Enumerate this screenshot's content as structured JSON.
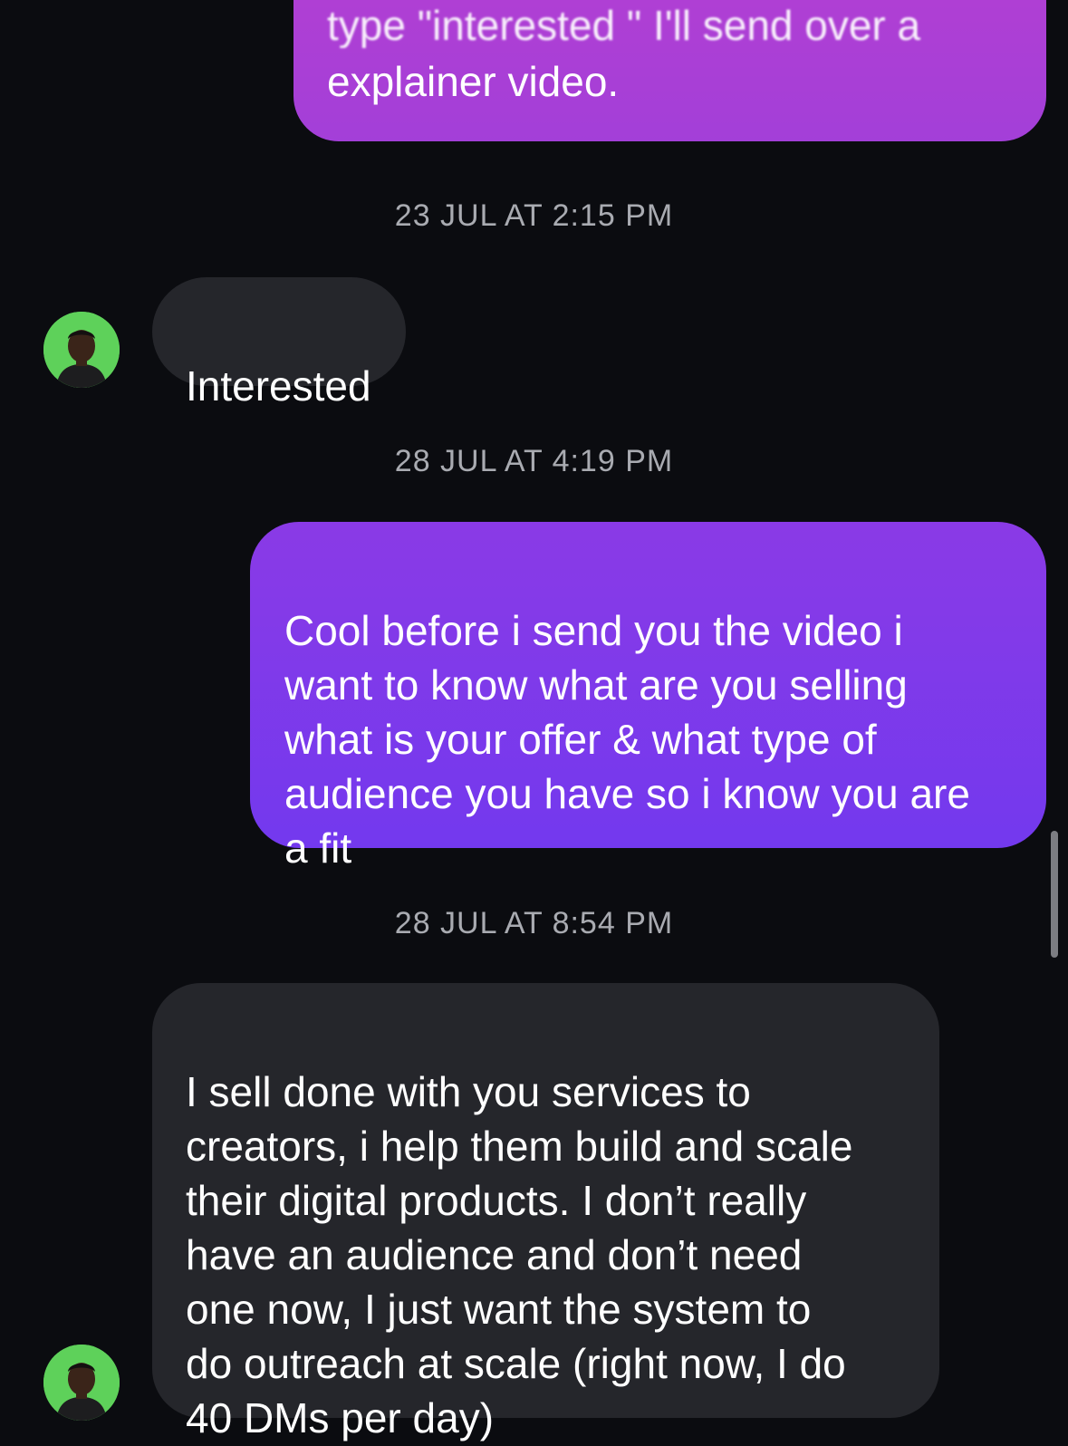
{
  "messages": [
    {
      "direction": "outgoing",
      "partial_line": "type \"interested \" I'll send over a",
      "text": "explainer video."
    },
    {
      "timestamp": "23 JUL AT 2:15 PM"
    },
    {
      "direction": "incoming",
      "text": "Interested"
    },
    {
      "timestamp": "28 JUL AT 4:19 PM"
    },
    {
      "direction": "outgoing",
      "text": "Cool before i send you the video i\nwant to know what are you selling\nwhat is your offer & what type of\naudience you have so i know you are\na fit"
    },
    {
      "timestamp": "28 JUL AT 8:54 PM"
    },
    {
      "direction": "incoming",
      "text": "I sell done with you services to\ncreators, i help them build and scale\ntheir digital products. I don’t really\nhave an audience and don’t need\none now, I just want the system to\ndo outreach at scale (right now, I do\n40 DMs per day)"
    }
  ],
  "colors": {
    "background": "#0b0c10",
    "incoming_bubble": "#25262b",
    "outgoing_bubble_top": "#b43fd2",
    "outgoing_bubble": "#7339ee",
    "timestamp_text": "#a9abb1",
    "avatar_background": "#5ed15a"
  },
  "icons": {
    "avatar": "contact-avatar-photo"
  }
}
